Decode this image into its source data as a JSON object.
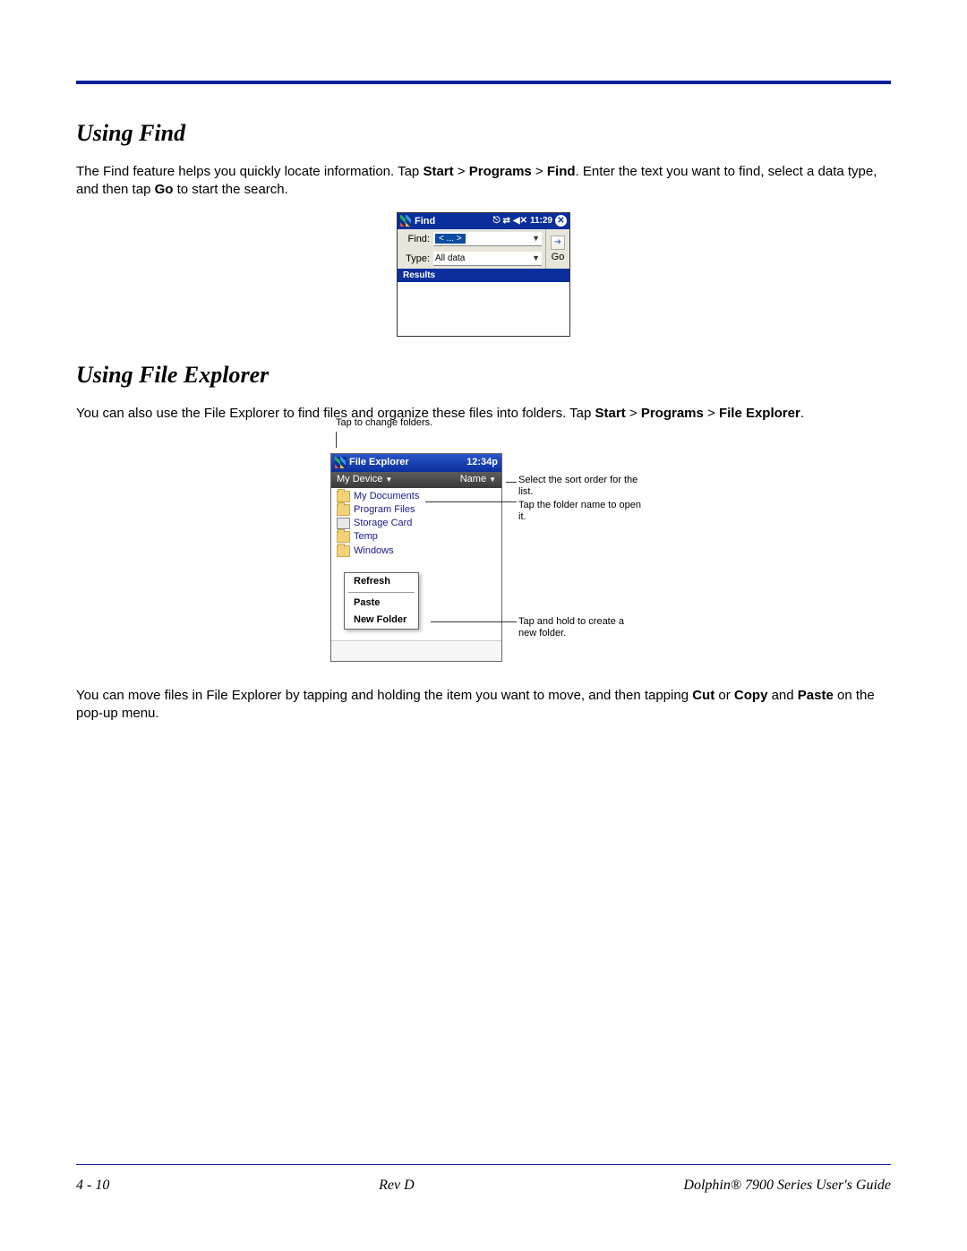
{
  "sections": {
    "using_find": {
      "heading": "Using Find",
      "para_parts": [
        "The Find feature helps you quickly locate information. Tap ",
        "Start",
        " > ",
        "Programs",
        " > ",
        "Find",
        ". Enter the text you want to find, select a data type, and then tap ",
        "Go",
        " to start the search."
      ]
    },
    "using_file_explorer": {
      "heading": "Using File Explorer",
      "para1_parts": [
        "You can also use the File Explorer to find files and organize these files into folders. Tap ",
        "Start",
        " > ",
        "Programs",
        " > ",
        "File Explorer",
        "."
      ],
      "para2_parts": [
        "You can move files in File Explorer by tapping and holding the item you want to move, and then tapping ",
        "Cut",
        " or ",
        "Copy",
        " and ",
        "Paste",
        " on the pop-up menu."
      ]
    }
  },
  "find_screenshot": {
    "title": "Find",
    "time": "11:29",
    "find_label": "Find:",
    "find_value": "< ... >",
    "type_label": "Type:",
    "type_value": "All data",
    "go_label": "Go",
    "results_label": "Results"
  },
  "fe_screenshot": {
    "title": "File Explorer",
    "time": "12:34p",
    "path_label": "My Device",
    "sort_label": "Name",
    "items": [
      {
        "icon": "folder",
        "label": "My Documents"
      },
      {
        "icon": "folder",
        "label": "Program Files"
      },
      {
        "icon": "card",
        "label": "Storage Card"
      },
      {
        "icon": "folder",
        "label": "Temp"
      },
      {
        "icon": "folder",
        "label": "Windows"
      }
    ],
    "context_menu": {
      "refresh": "Refresh",
      "paste": "Paste",
      "new_folder": "New Folder"
    },
    "callouts": {
      "top": "Tap to change folders.",
      "sort": "Select the sort order for the list.",
      "open": "Tap the folder name to open it.",
      "hold": "Tap and hold to create a new folder."
    }
  },
  "footer": {
    "left": "4 - 10",
    "center": "Rev D",
    "right": "Dolphin® 7900 Series User's Guide"
  }
}
